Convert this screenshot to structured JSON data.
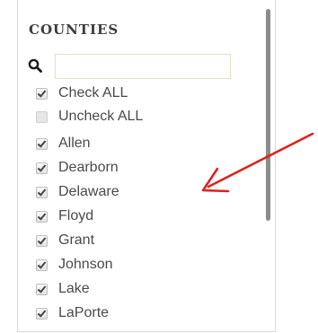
{
  "panel": {
    "title": "COUNTIES",
    "search": {
      "placeholder": "",
      "value": ""
    },
    "items": [
      {
        "label": "Check ALL",
        "checked": true
      },
      {
        "label": "Uncheck ALL",
        "checked": false
      },
      {
        "label": "Allen",
        "checked": true
      },
      {
        "label": "Dearborn",
        "checked": true
      },
      {
        "label": "Delaware",
        "checked": true
      },
      {
        "label": "Floyd",
        "checked": true
      },
      {
        "label": "Grant",
        "checked": true
      },
      {
        "label": "Johnson",
        "checked": true
      },
      {
        "label": "Lake",
        "checked": true
      },
      {
        "label": "LaPorte",
        "checked": true
      }
    ]
  },
  "icons": {
    "search": "search-icon",
    "annotation": "red-arrow-icon"
  },
  "colors": {
    "arrow": "#e0201b",
    "scrollbar": "#8c8c8c",
    "title": "#3d3d3d"
  }
}
